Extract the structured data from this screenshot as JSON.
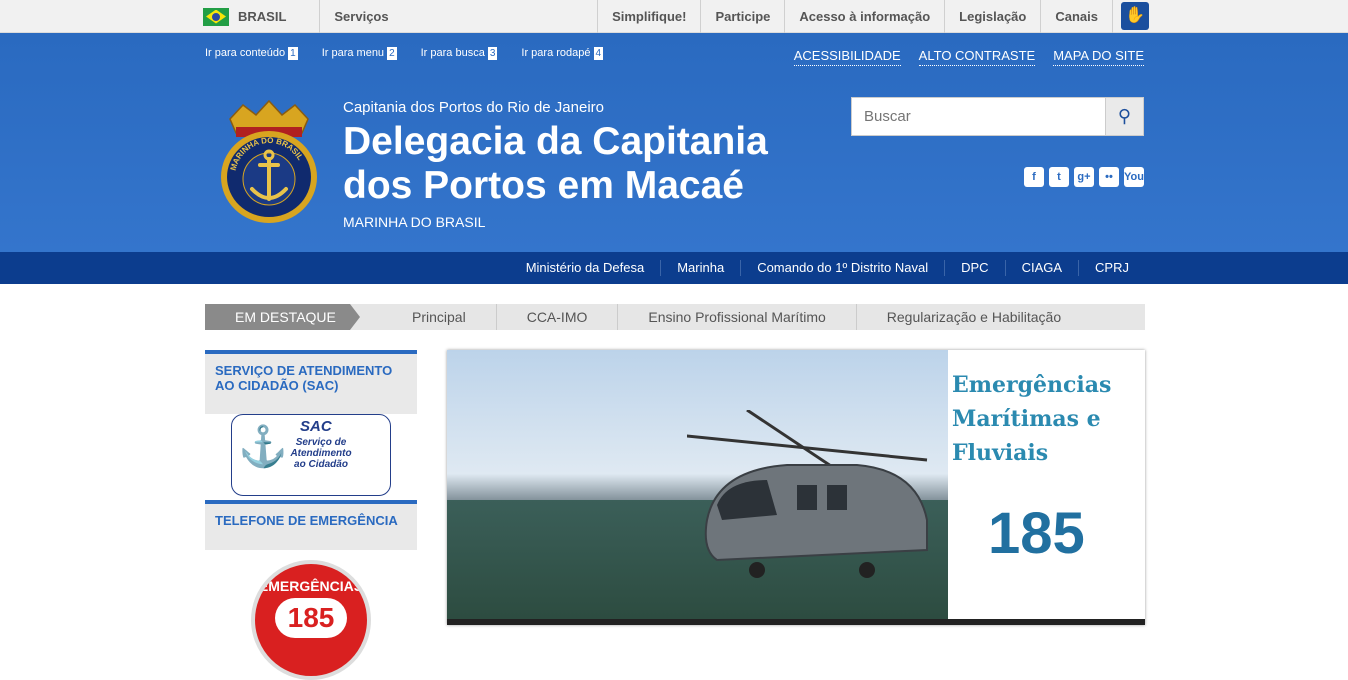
{
  "topbar": {
    "country": "BRASIL",
    "services": "Serviços",
    "links": [
      "Simplifique!",
      "Participe",
      "Acesso à informação",
      "Legislação",
      "Canais"
    ]
  },
  "skip": [
    {
      "label": "Ir para conteúdo",
      "n": "1"
    },
    {
      "label": "Ir para menu",
      "n": "2"
    },
    {
      "label": "Ir para busca",
      "n": "3"
    },
    {
      "label": "Ir para rodapé",
      "n": "4"
    }
  ],
  "access": [
    "ACESSIBILIDADE",
    "ALTO CONTRASTE",
    "MAPA DO SITE"
  ],
  "header": {
    "subtitle": "Capitania dos Portos do Rio de Janeiro",
    "title": "Delegacia da Capitania dos Portos em Macaé",
    "org": "MARINHA DO BRASIL",
    "logo_text": "MARINHA DO BRASIL"
  },
  "search": {
    "placeholder": "Buscar"
  },
  "social": [
    "f",
    "t",
    "g+",
    "••",
    "You"
  ],
  "nav": [
    "Ministério da Defesa",
    "Marinha",
    "Comando do 1º Distrito Naval",
    "DPC",
    "CIAGA",
    "CPRJ"
  ],
  "tabs": {
    "highlight": "EM DESTAQUE",
    "items": [
      "Principal",
      "CCA-IMO",
      "Ensino Profissional Marítimo",
      "Regularização e Habilitação"
    ]
  },
  "sidebar": {
    "sac_title": "SERVIÇO DE ATENDIMENTO AO CIDADÃO (SAC)",
    "sac_logo_title": "SAC",
    "sac_logo_sub": "Serviço de Atendimento ao Cidadão",
    "emerg_title": "TELEFONE DE EMERGÊNCIA",
    "emerg_badge_text": "EMERGÊNCIAS",
    "emerg_badge_num": "185"
  },
  "banner": {
    "text": "Emergências Marítimas e Fluviais",
    "number": "185"
  },
  "colors": {
    "header_blue": "#2a6ac0",
    "nav_dark": "#0c3d8e"
  }
}
